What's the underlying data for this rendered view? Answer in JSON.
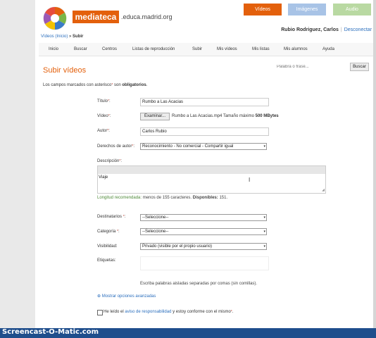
{
  "brand": {
    "name": "mediateca",
    "domain": ".educa.madrid.org"
  },
  "top_tabs": [
    {
      "label": "Vídeos",
      "color": "#e3600c"
    },
    {
      "label": "Imágenes",
      "color": "#a8c3e6"
    },
    {
      "label": "Audio",
      "color": "#b9d9a2"
    }
  ],
  "user": {
    "name": "Rubio Rodriguez, Carlos",
    "separator": "|",
    "logout": "Desconectar"
  },
  "breadcrumb": {
    "home": "Vídeos (Inicio)",
    "sep": "»",
    "current": "Subir"
  },
  "nav": [
    "Inicio",
    "Buscar",
    "Centros",
    "Listas de reproducción",
    "Subir",
    "Mis vídeos",
    "Mis listas",
    "Mis alumnos",
    "Ayuda"
  ],
  "page_title": "Subir vídeos",
  "search": {
    "placeholder": "Palabra o frase...",
    "button": "Buscar"
  },
  "required_note": {
    "pre": "Los campos marcados con asterisco",
    "star": "*",
    "mid": " son ",
    "bold": "obligatorios",
    "post": "."
  },
  "form": {
    "title": {
      "label": "Título",
      "value": "Rumbo a Las Acacias"
    },
    "video": {
      "label": "Vídeo",
      "button": "Examinar...",
      "file": "Rumbo a Las Acacias.mp4",
      "size_pre": "Tamaño máximo",
      "size": "500 MBytes"
    },
    "author": {
      "label": "Autor",
      "value": "Carlos Rubio"
    },
    "rights": {
      "label": "Derechos de autor",
      "value": "Reconocimiento - No comercial - Compartir igual"
    },
    "description": {
      "label": "Descripción",
      "value": "Viaje",
      "hint_label": "Longitud recomendada:",
      "hint_pre": "menos de 155 caracteres.",
      "hint_avail_label": "Disponibles:",
      "hint_avail": "151"
    },
    "recipients": {
      "label": "Destinatarios",
      "value": "--Seleccione--"
    },
    "category": {
      "label": "Categoría",
      "value": "--Seleccione--"
    },
    "visibility": {
      "label": "Visibilidad",
      "value": "Privado (visible por el propio usuario)"
    },
    "tags": {
      "label": "Etiquetas",
      "hint": "Escriba palabras aisladas separadas por comas (sin comillas)."
    },
    "advanced": "Mostrar opciones avanzadas",
    "terms": {
      "pre": "He leído el",
      "link": "aviso de responsabilidad",
      "post": "y estoy conforme con el mismo",
      "star": "*",
      "end": "."
    }
  },
  "req_star": "*",
  "watermark": "Screencast-O-Matic.com"
}
